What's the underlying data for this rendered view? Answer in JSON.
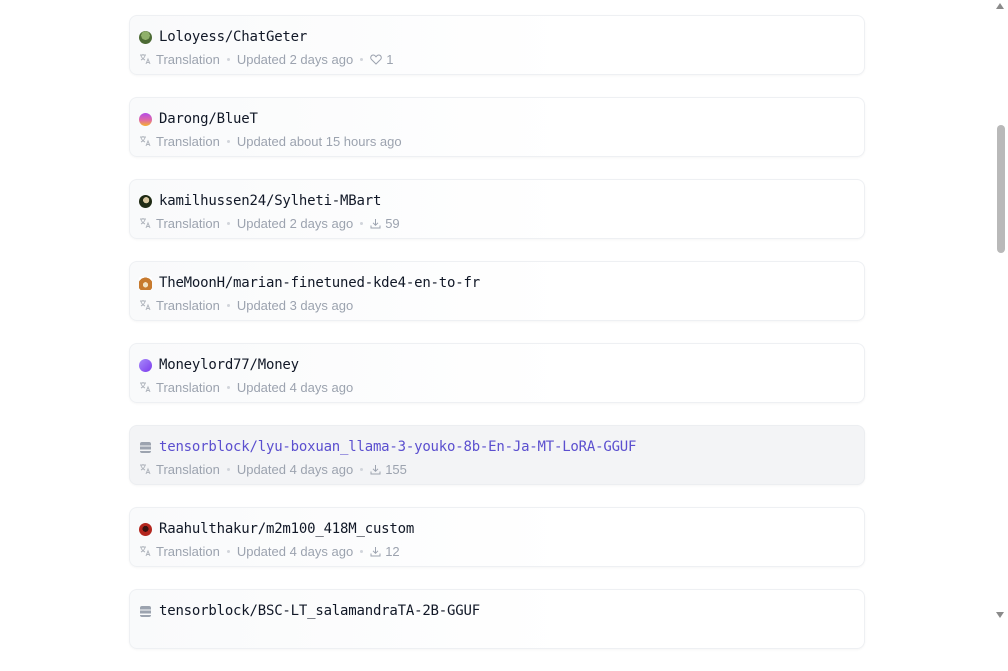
{
  "models": [
    {
      "name": "Loloyess/ChatGeter",
      "avatar": "pixel-avatar",
      "avatar_color": "#6b8e4e",
      "task": "Translation",
      "updated": "Updated 2 days ago",
      "stat_type": "likes",
      "stat_value": "1",
      "highlighted": false
    },
    {
      "name": "Darong/BlueT",
      "avatar": "gradient-avatar",
      "avatar_color": "#c14ee0",
      "task": "Translation",
      "updated": "Updated about 15 hours ago",
      "stat_type": "",
      "stat_value": "",
      "highlighted": false
    },
    {
      "name": "kamilhussen24/Sylheti-MBart",
      "avatar": "photo-avatar",
      "avatar_color": "#2e3a1f",
      "task": "Translation",
      "updated": "Updated 2 days ago",
      "stat_type": "downloads",
      "stat_value": "59",
      "highlighted": false
    },
    {
      "name": "TheMoonH/marian-finetuned-kde4-en-to-fr",
      "avatar": "fox-avatar",
      "avatar_color": "#c77a2e",
      "task": "Translation",
      "updated": "Updated 3 days ago",
      "stat_type": "",
      "stat_value": "",
      "highlighted": false
    },
    {
      "name": "Moneylord77/Money",
      "avatar": "gradient-avatar",
      "avatar_color": "#8b5cf6",
      "task": "Translation",
      "updated": "Updated 4 days ago",
      "stat_type": "",
      "stat_value": "",
      "highlighted": false
    },
    {
      "name": "tensorblock/lyu-boxuan_llama-3-youko-8b-En-Ja-MT-LoRA-GGUF",
      "avatar": "org-avatar",
      "avatar_color": "#9ca3af",
      "task": "Translation",
      "updated": "Updated 4 days ago",
      "stat_type": "downloads",
      "stat_value": "155",
      "highlighted": true
    },
    {
      "name": "Raahulthakur/m2m100_418M_custom",
      "avatar": "photo-avatar",
      "avatar_color": "#b3261e",
      "task": "Translation",
      "updated": "Updated 4 days ago",
      "stat_type": "downloads",
      "stat_value": "12",
      "highlighted": false
    },
    {
      "name": "tensorblock/BSC-LT_salamandraTA-2B-GGUF",
      "avatar": "org-avatar",
      "avatar_color": "#9ca3af",
      "task": "",
      "updated": "",
      "stat_type": "",
      "stat_value": "",
      "highlighted": false
    }
  ],
  "icons": {
    "task": "translate-icon",
    "likes": "heart-icon",
    "downloads": "download-icon"
  },
  "colors": {
    "link_highlight": "#5b4fcf",
    "meta_text": "#9ca3af"
  }
}
